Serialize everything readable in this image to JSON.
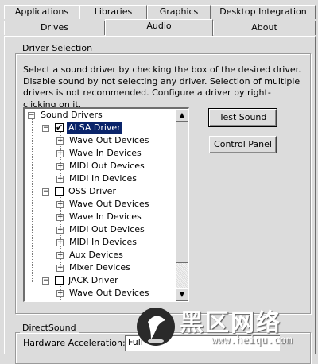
{
  "tabs_row1": [
    {
      "label": "Applications"
    },
    {
      "label": "Libraries"
    },
    {
      "label": "Graphics"
    },
    {
      "label": "Desktop Integration"
    }
  ],
  "tabs_row2": [
    {
      "label": "Drives"
    },
    {
      "label": "Audio"
    },
    {
      "label": "About"
    }
  ],
  "driver_selection": {
    "title": "Driver Selection",
    "description": "Select a sound driver by checking the box of the desired driver. Disable sound by not selecting any driver. Selection of multiple drivers is not recommended. Configure a driver by right-clicking on it.",
    "test_sound_label": "Test Sound",
    "control_panel_label": "Control Panel"
  },
  "tree": {
    "root": "Sound Drivers",
    "drivers": [
      {
        "label": "ALSA Driver",
        "checked": true,
        "selected": true,
        "children": [
          "Wave Out Devices",
          "Wave In Devices",
          "MIDI Out Devices",
          "MIDI In Devices"
        ]
      },
      {
        "label": "OSS Driver",
        "checked": false,
        "selected": false,
        "children": [
          "Wave Out Devices",
          "Wave In Devices",
          "MIDI Out Devices",
          "MIDI In Devices",
          "Aux Devices",
          "Mixer Devices"
        ]
      },
      {
        "label": "JACK Driver",
        "checked": false,
        "selected": false,
        "children": [
          "Wave Out Devices"
        ]
      }
    ]
  },
  "directsound": {
    "title": "DirectSound",
    "hw_accel_label": "Hardware Acceleration:",
    "hw_accel_value": "Full"
  },
  "watermark": {
    "text_cn": "黑区网络",
    "text_url": "www.heiqu.com"
  }
}
